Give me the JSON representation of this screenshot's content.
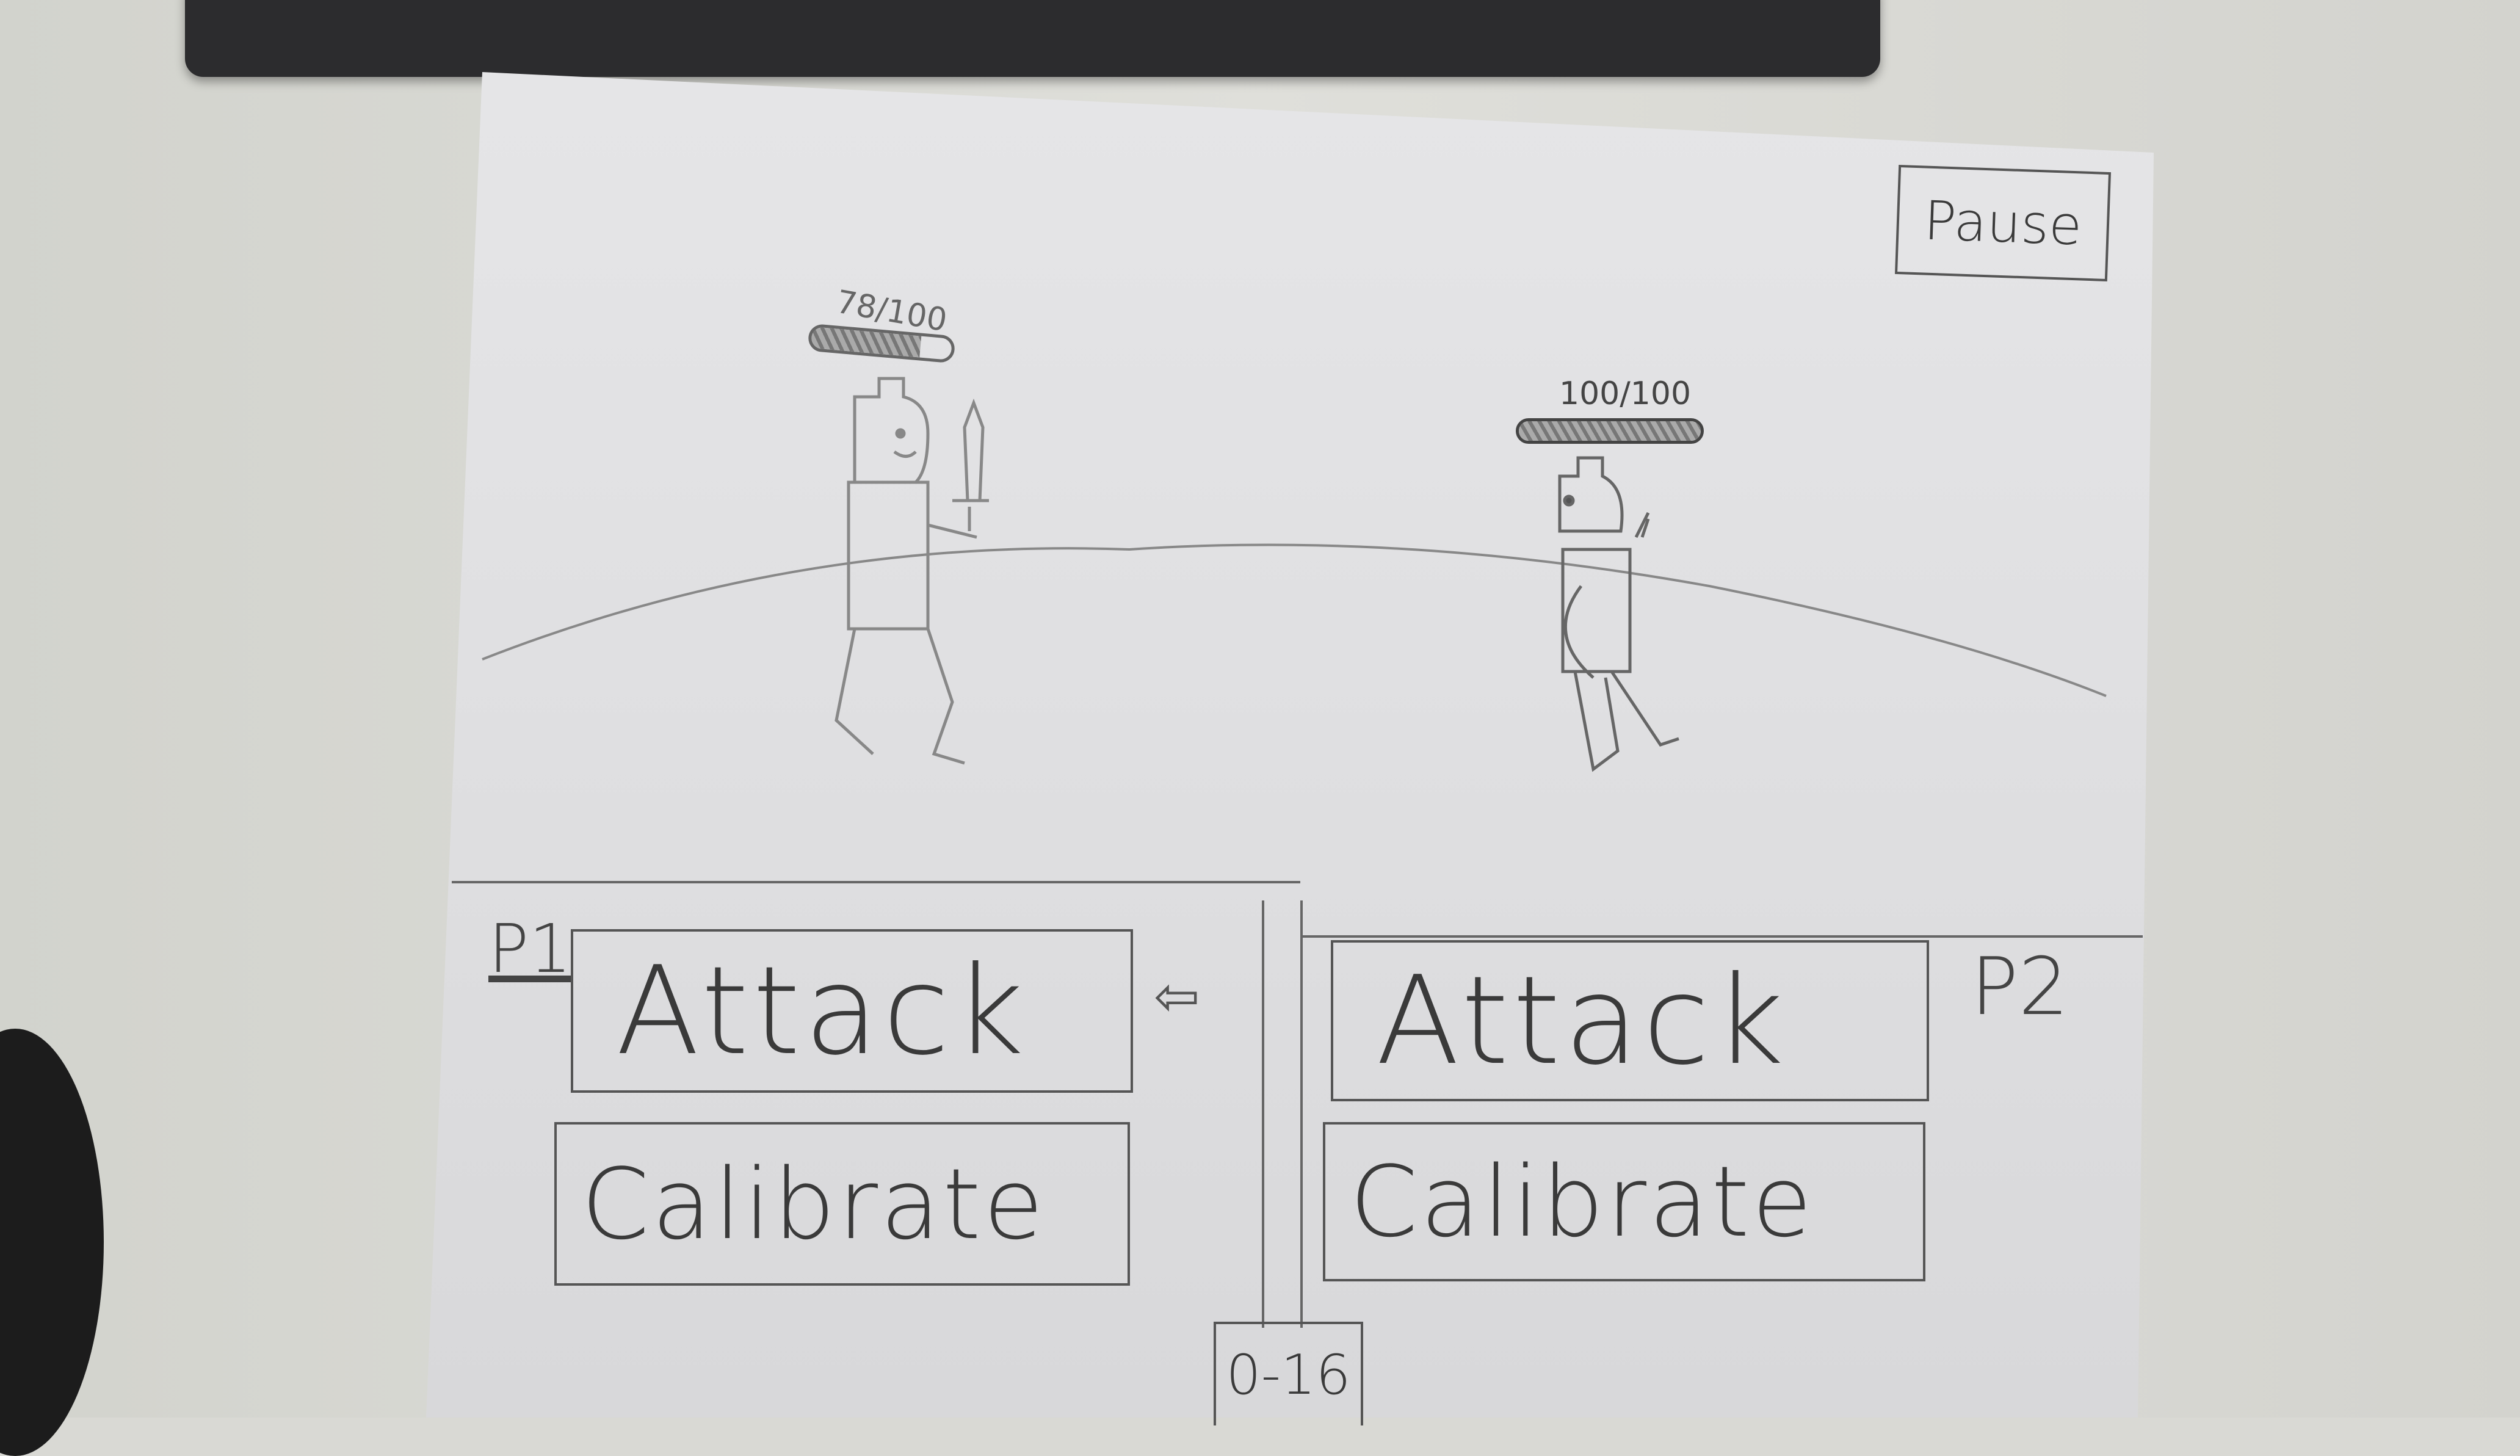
{
  "header": {
    "pause_label": "Pause"
  },
  "players": [
    {
      "id_label": "P1",
      "health_text": "78/100",
      "health_fraction": 0.78,
      "weapon": "sword",
      "attack_label": "Attack",
      "calibrate_label": "Calibrate"
    },
    {
      "id_label": "P2",
      "health_text": "100/100",
      "health_fraction": 1.0,
      "weapon": "bow",
      "attack_label": "Attack",
      "calibrate_label": "Calibrate"
    }
  ],
  "turn_indicator": {
    "icon": "arrow-left-icon"
  },
  "score": {
    "text": "0-16"
  },
  "colors": {
    "paper": "#e3e3e5",
    "ink": "#444444"
  }
}
